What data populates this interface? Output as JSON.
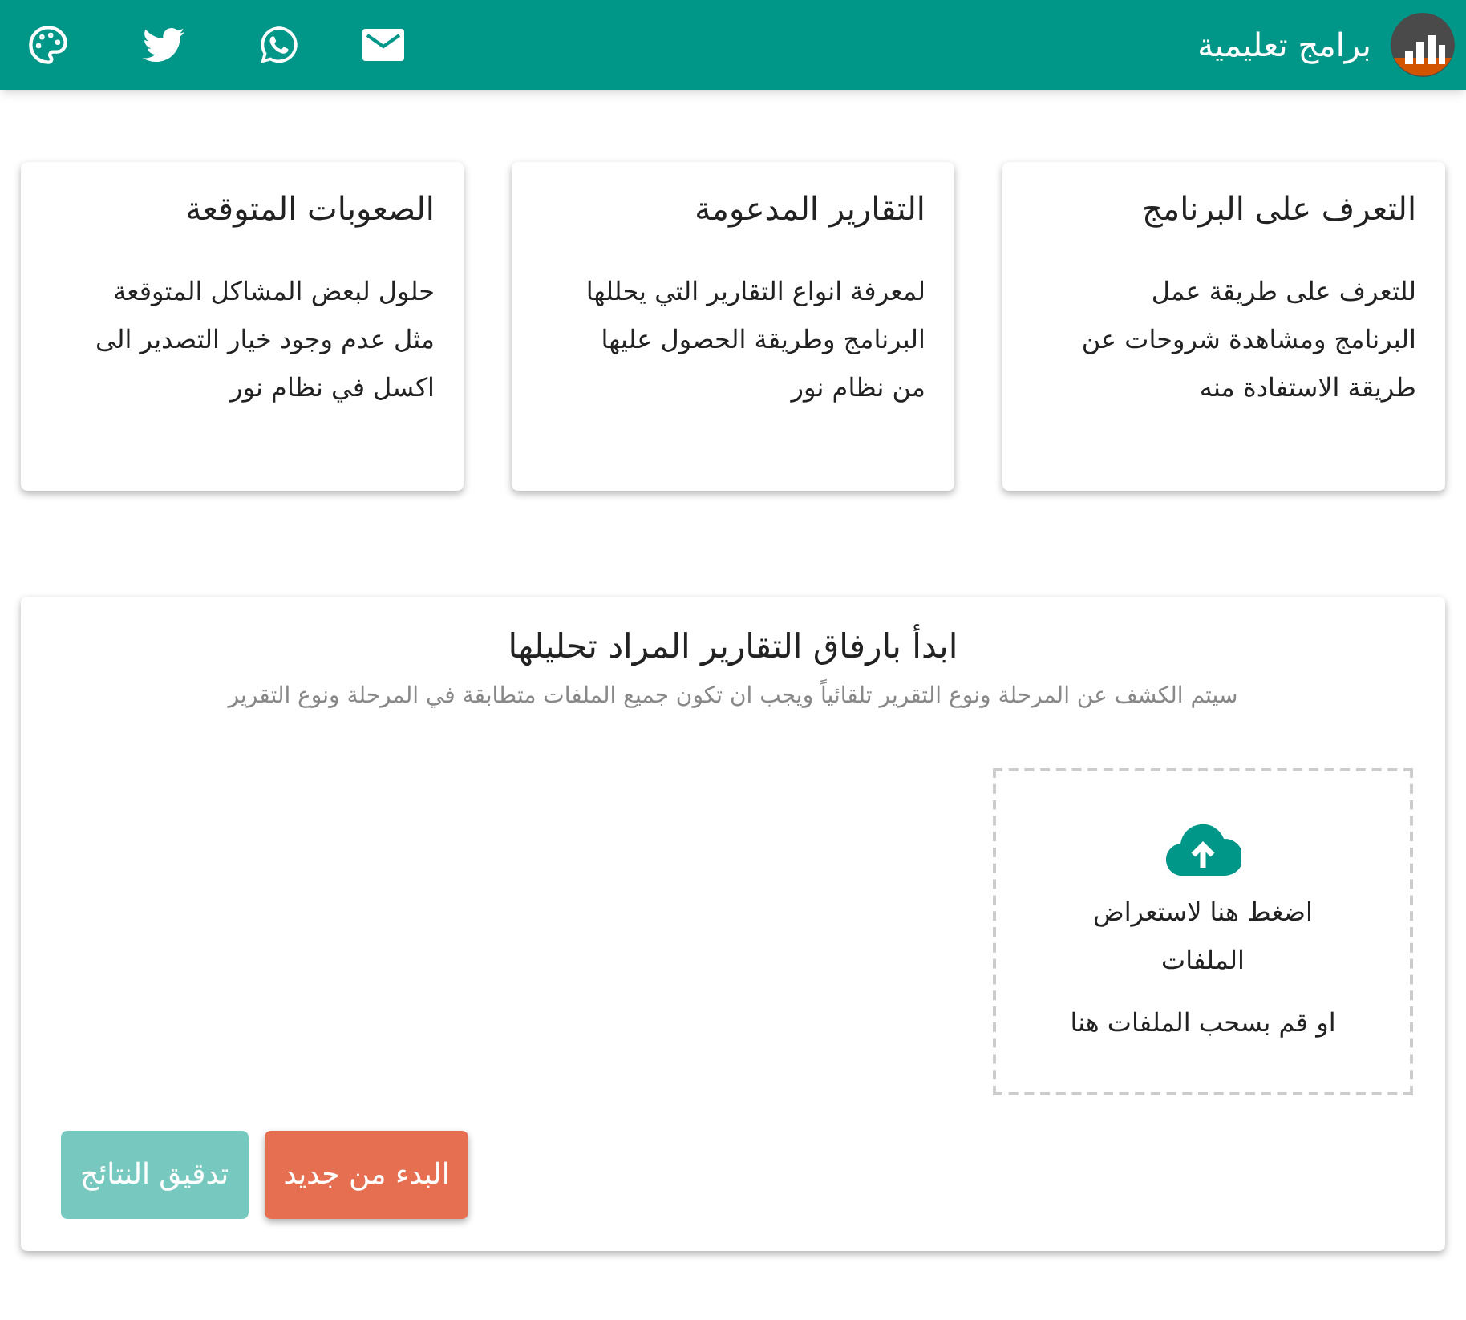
{
  "header": {
    "title": "برامج تعليمية"
  },
  "cards": [
    {
      "title": "التعرف على البرنامج",
      "text": "للتعرف على طريقة عمل البرنامج ومشاهدة شروحات عن طريقة الاستفادة منه"
    },
    {
      "title": "التقارير المدعومة",
      "text": "لمعرفة انواع التقارير التي يحللها البرنامج وطريقة الحصول عليها من نظام نور"
    },
    {
      "title": "الصعوبات المتوقعة",
      "text": "حلول لبعض المشاكل المتوقعة مثل عدم وجود خيار التصدير الى اكسل في نظام نور"
    }
  ],
  "upload_panel": {
    "title": "ابدأ بارفاق التقارير المراد تحليلها",
    "subtitle": "سيتم الكشف عن المرحلة ونوع التقرير تلقائياً ويجب ان تكون جميع الملفات متطابقة في المرحلة ونوع التقرير",
    "dropzone": {
      "browse_text": "اضغط هنا لاستعراض الملفات",
      "drag_text": "او قم بسحب الملفات هنا"
    },
    "buttons": [
      {
        "label": "البدء من جديد",
        "kind": "restart",
        "disabled": false
      },
      {
        "label": "تدقيق النتائج",
        "kind": "check",
        "disabled": true
      }
    ]
  }
}
